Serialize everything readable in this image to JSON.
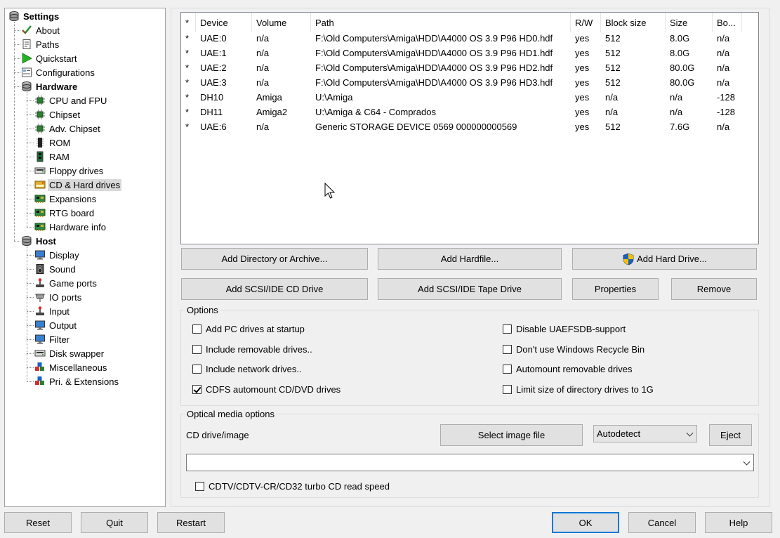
{
  "tree": {
    "root": "Settings",
    "items": [
      {
        "label": "About",
        "icon": "check-icon",
        "level": 1
      },
      {
        "label": "Paths",
        "icon": "document-icon",
        "level": 1
      },
      {
        "label": "Quickstart",
        "icon": "play-icon",
        "level": 1
      },
      {
        "label": "Configurations",
        "icon": "config-icon",
        "level": 1
      },
      {
        "label": "Hardware",
        "icon": "disk-stack-icon",
        "level": 1,
        "bold": true
      },
      {
        "label": "CPU and FPU",
        "icon": "chip-icon",
        "level": 2
      },
      {
        "label": "Chipset",
        "icon": "chip-icon",
        "level": 2
      },
      {
        "label": "Adv. Chipset",
        "icon": "chip-icon",
        "level": 2
      },
      {
        "label": "ROM",
        "icon": "rom-chip-icon",
        "level": 2
      },
      {
        "label": "RAM",
        "icon": "ram-icon",
        "level": 2
      },
      {
        "label": "Floppy drives",
        "icon": "floppy-drive-icon",
        "level": 2
      },
      {
        "label": "CD & Hard drives",
        "icon": "hard-drive-icon",
        "level": 2,
        "selected": true
      },
      {
        "label": "Expansions",
        "icon": "expansion-board-icon",
        "level": 2
      },
      {
        "label": "RTG board",
        "icon": "expansion-board-icon",
        "level": 2
      },
      {
        "label": "Hardware info",
        "icon": "expansion-board-icon",
        "level": 2
      },
      {
        "label": "Host",
        "icon": "disk-stack-icon",
        "level": 1,
        "bold": true
      },
      {
        "label": "Display",
        "icon": "monitor-icon",
        "level": 2
      },
      {
        "label": "Sound",
        "icon": "speaker-icon",
        "level": 2
      },
      {
        "label": "Game ports",
        "icon": "joystick-icon",
        "level": 2
      },
      {
        "label": "IO ports",
        "icon": "connector-icon",
        "level": 2
      },
      {
        "label": "Input",
        "icon": "joystick-icon",
        "level": 2
      },
      {
        "label": "Output",
        "icon": "monitor-icon",
        "level": 2
      },
      {
        "label": "Filter",
        "icon": "monitor-icon",
        "level": 2
      },
      {
        "label": "Disk swapper",
        "icon": "floppy-drive-icon",
        "level": 2
      },
      {
        "label": "Miscellaneous",
        "icon": "blocks-icon",
        "level": 2
      },
      {
        "label": "Pri. & Extensions",
        "icon": "blocks-icon",
        "level": 2
      }
    ]
  },
  "drives": {
    "columns": [
      "*",
      "Device",
      "Volume",
      "Path",
      "R/W",
      "Block size",
      "Size",
      "Bo..."
    ],
    "rows": [
      [
        "*",
        "UAE:0",
        "n/a",
        "F:\\Old Computers\\Amiga\\HDD\\A4000 OS 3.9 P96 HD0.hdf",
        "yes",
        "512",
        "8.0G",
        "n/a"
      ],
      [
        "*",
        "UAE:1",
        "n/a",
        "F:\\Old Computers\\Amiga\\HDD\\A4000 OS 3.9 P96 HD1.hdf",
        "yes",
        "512",
        "8.0G",
        "n/a"
      ],
      [
        "*",
        "UAE:2",
        "n/a",
        "F:\\Old Computers\\Amiga\\HDD\\A4000 OS 3.9 P96 HD2.hdf",
        "yes",
        "512",
        "80.0G",
        "n/a"
      ],
      [
        "*",
        "UAE:3",
        "n/a",
        "F:\\Old Computers\\Amiga\\HDD\\A4000 OS 3.9 P96 HD3.hdf",
        "yes",
        "512",
        "80.0G",
        "n/a"
      ],
      [
        "*",
        "DH10",
        "Amiga",
        "U:\\Amiga",
        "yes",
        "n/a",
        "n/a",
        "-128"
      ],
      [
        "*",
        "DH11",
        "Amiga2",
        "U:\\Amiga & C64 - Comprados",
        "yes",
        "n/a",
        "n/a",
        "-128"
      ],
      [
        "*",
        "UAE:6",
        "n/a",
        "Generic STORAGE DEVICE 0569 000000000569",
        "yes",
        "512",
        "7.6G",
        "n/a"
      ]
    ]
  },
  "buttons": {
    "add_directory": "Add Directory or Archive...",
    "add_hardfile": "Add Hardfile...",
    "add_hard_drive": "Add Hard Drive...",
    "add_cd_drive": "Add SCSI/IDE CD Drive",
    "add_tape_drive": "Add SCSI/IDE Tape Drive",
    "properties": "Properties",
    "remove": "Remove"
  },
  "options": {
    "title": "Options",
    "left": [
      {
        "label": "Add PC drives at startup",
        "checked": false
      },
      {
        "label": "Include removable drives..",
        "checked": false
      },
      {
        "label": "Include network drives..",
        "checked": false
      },
      {
        "label": "CDFS automount CD/DVD drives",
        "checked": true
      }
    ],
    "right": [
      {
        "label": "Disable UAEFSDB-support",
        "checked": false
      },
      {
        "label": "Don't use Windows Recycle Bin",
        "checked": false
      },
      {
        "label": "Automount removable drives",
        "checked": false
      },
      {
        "label": "Limit size of directory drives to 1G",
        "checked": false
      }
    ]
  },
  "optical": {
    "title": "Optical media options",
    "cd_label": "CD drive/image",
    "select_image": "Select image file",
    "mode_value": "Autodetect",
    "eject": "Eject",
    "path_value": "",
    "turbo_label": "CDTV/CDTV-CR/CD32 turbo CD read speed",
    "turbo_checked": false
  },
  "bottom": {
    "reset": "Reset",
    "quit": "Quit",
    "restart": "Restart",
    "ok": "OK",
    "cancel": "Cancel",
    "help": "Help"
  }
}
